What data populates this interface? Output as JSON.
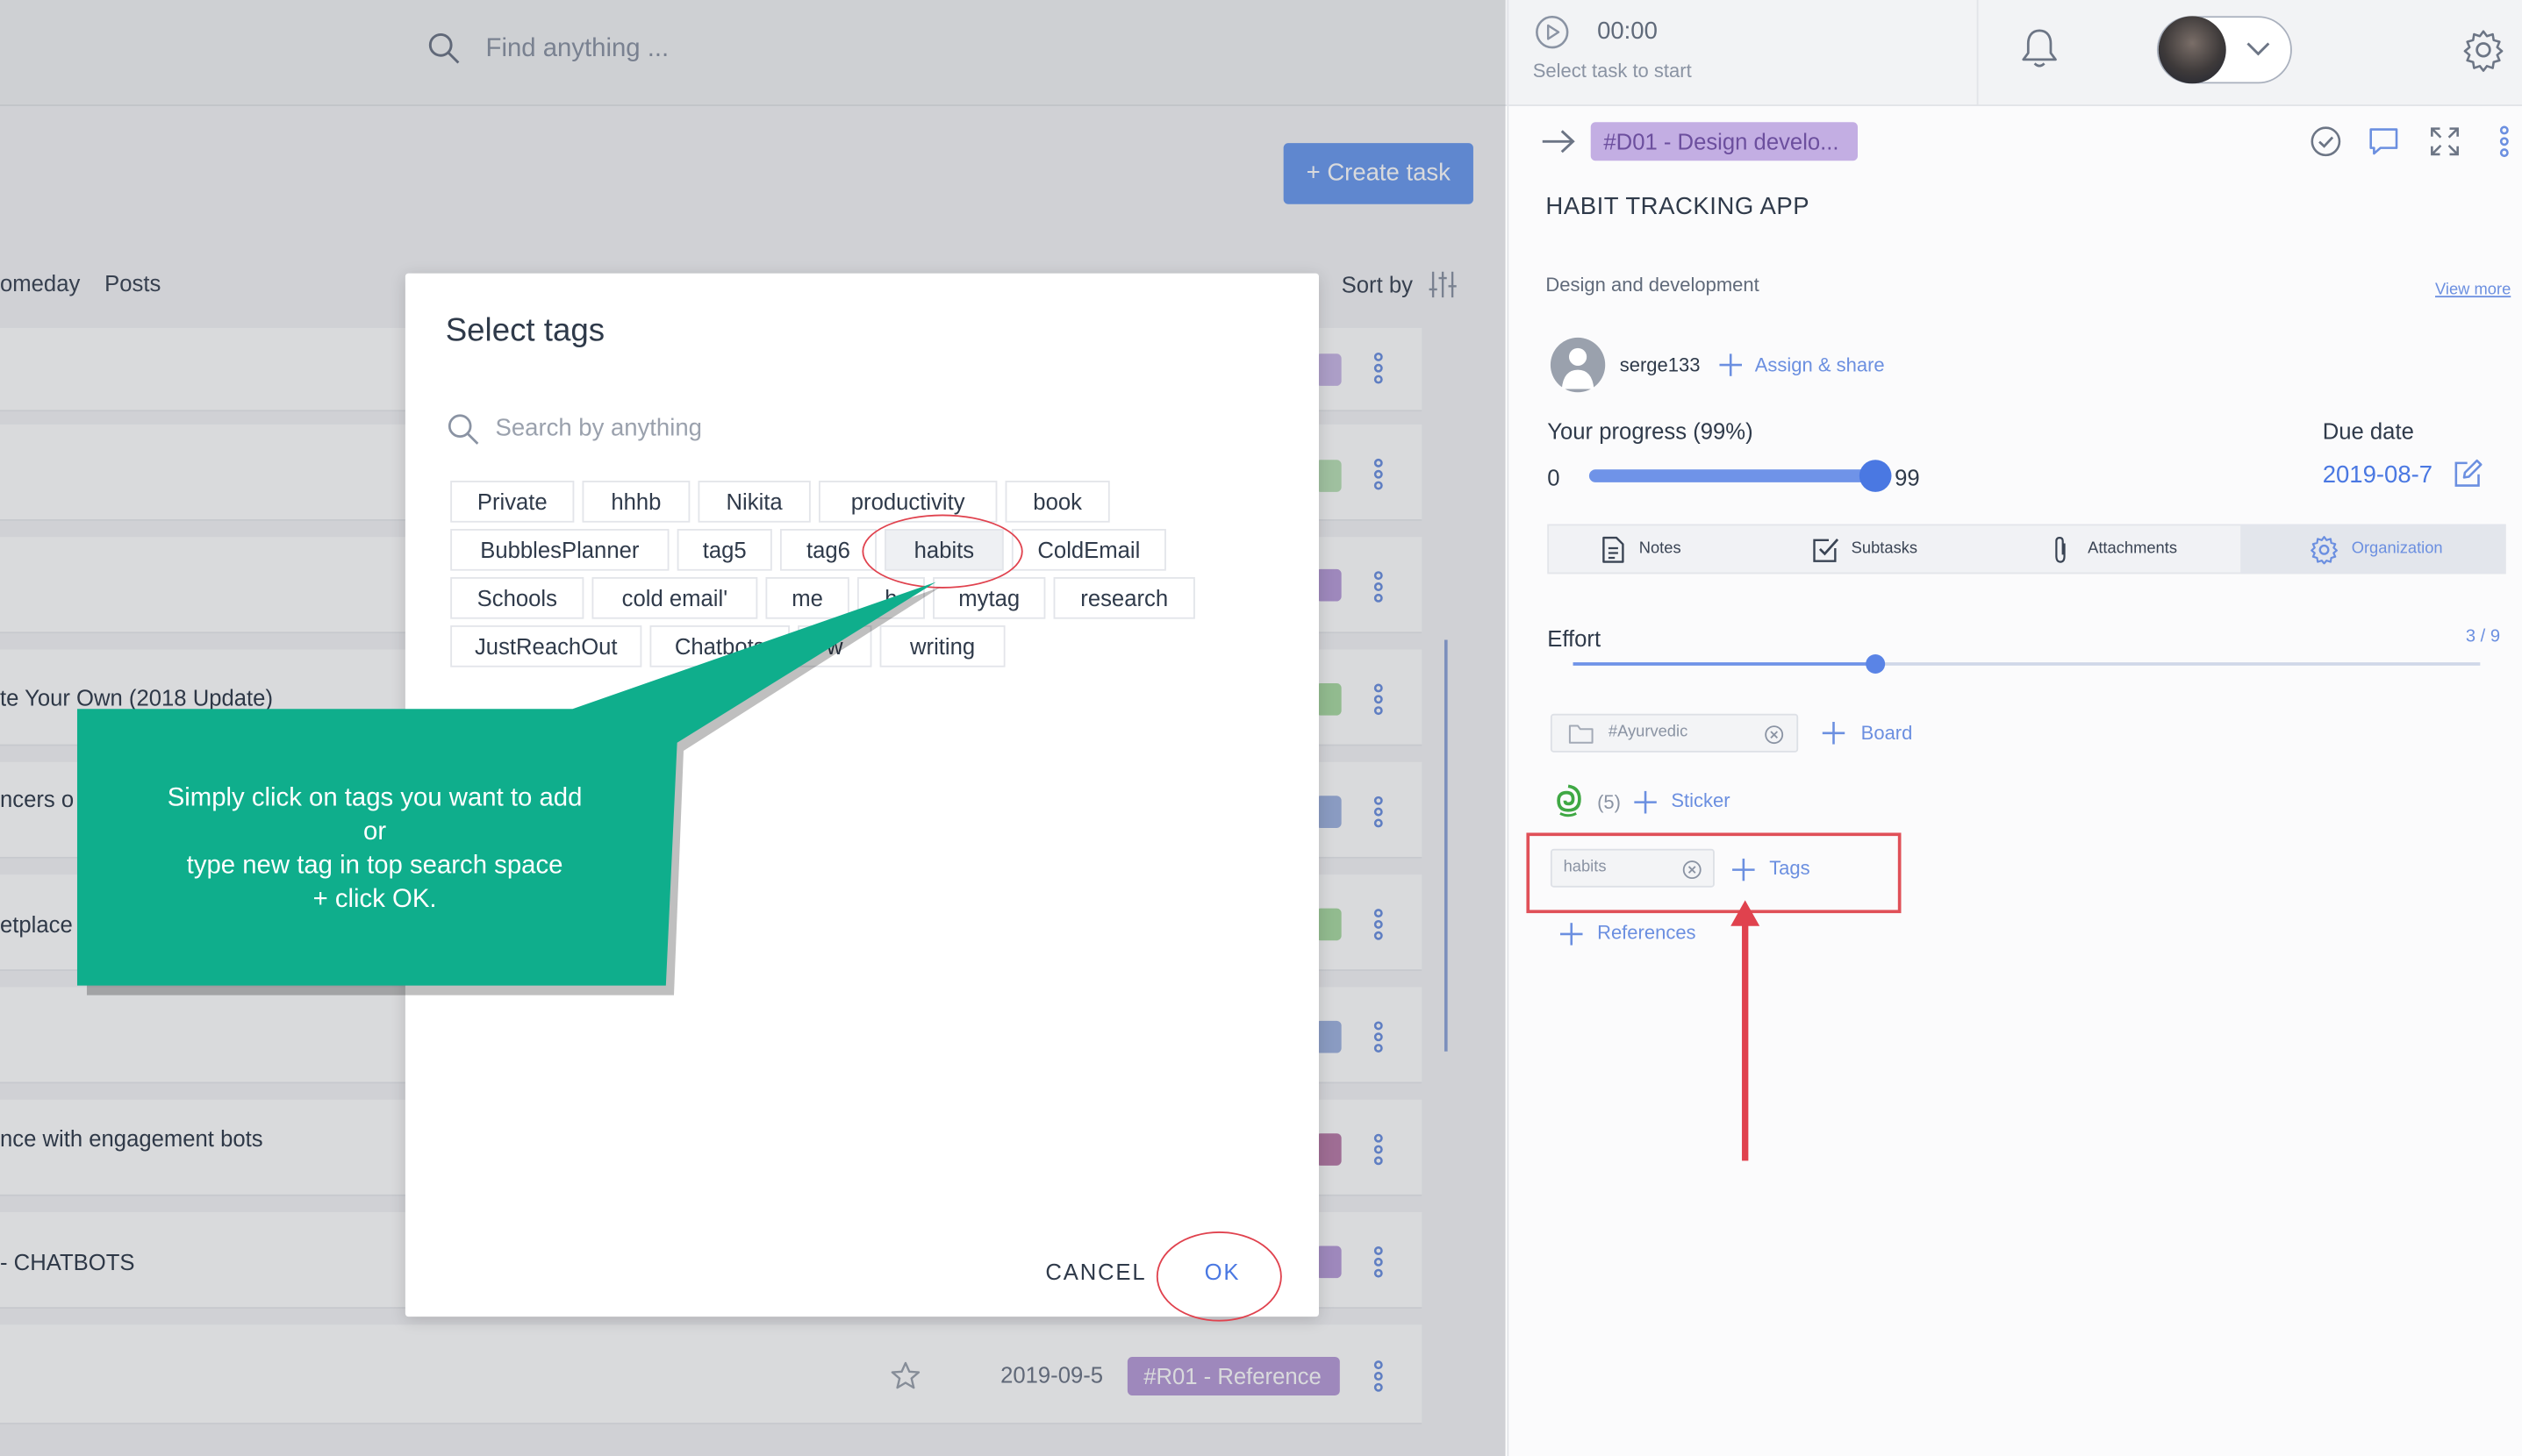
{
  "search": {
    "placeholder": "Find anything ..."
  },
  "timer": {
    "time": "00:00",
    "hint": "Select task to start"
  },
  "main": {
    "create_task": "+ Create task",
    "tabs": [
      "omeday",
      "Posts"
    ],
    "sort_by": "Sort by",
    "rows": [
      {
        "text": ""
      },
      {
        "text": ""
      },
      {
        "text": ""
      },
      {
        "text": "te Your Own (2018 Update)"
      },
      {
        "text": "ncers o"
      },
      {
        "text": "etplace"
      },
      {
        "text": ""
      },
      {
        "text": "nce with engagement bots"
      },
      {
        "text": " - CHATBOTS"
      }
    ],
    "bottom_row": {
      "date": "2019-09-5",
      "tag": "#R01 - Reference"
    }
  },
  "panel": {
    "id_tag": "#D01 - Design develo...",
    "title": "HABIT TRACKING APP",
    "description": "Design and development",
    "view_more": "View more",
    "user": "serge133",
    "assign": "Assign & share",
    "progress_label": "Your progress  (99%)",
    "progress": {
      "min": "0",
      "max_label": "99",
      "value_fraction": 0.99
    },
    "due_label": "Due date",
    "due_date": "2019-08-7",
    "tabs": [
      "Notes",
      "Subtasks",
      "Attachments",
      "Organization"
    ],
    "effort_label": "Effort",
    "effort_value": "3 / 9",
    "effort_fraction": 0.333,
    "board_chip": "#Ayurvedic",
    "board_link": "Board",
    "sticker_count": "(5)",
    "sticker_link": "Sticker",
    "tag_chip": "habits",
    "tags_link": "Tags",
    "references_link": "References"
  },
  "modal": {
    "title": "Select tags",
    "search_placeholder": "Search by anything",
    "tags": [
      "Private",
      "hhhb",
      "Nikita",
      "productivity",
      "book",
      "BubblesPlanner",
      "tag5",
      "tag6",
      "habits",
      "ColdEmail",
      "Schools",
      "cold email'",
      "me",
      "h",
      "mytag",
      "research",
      "JustReachOut",
      "Chatbots",
      "w",
      "writing"
    ],
    "cancel": "CANCEL",
    "ok": "OK"
  },
  "callout": {
    "text": "Simply click on tags you want to add\nor\ntype new tag in top search space\n+ click OK."
  },
  "colors": {
    "accent": "#4a78e2",
    "create_button": "#6b9af0",
    "callout": "#0fae8c",
    "annotation_red": "#e0424e"
  }
}
